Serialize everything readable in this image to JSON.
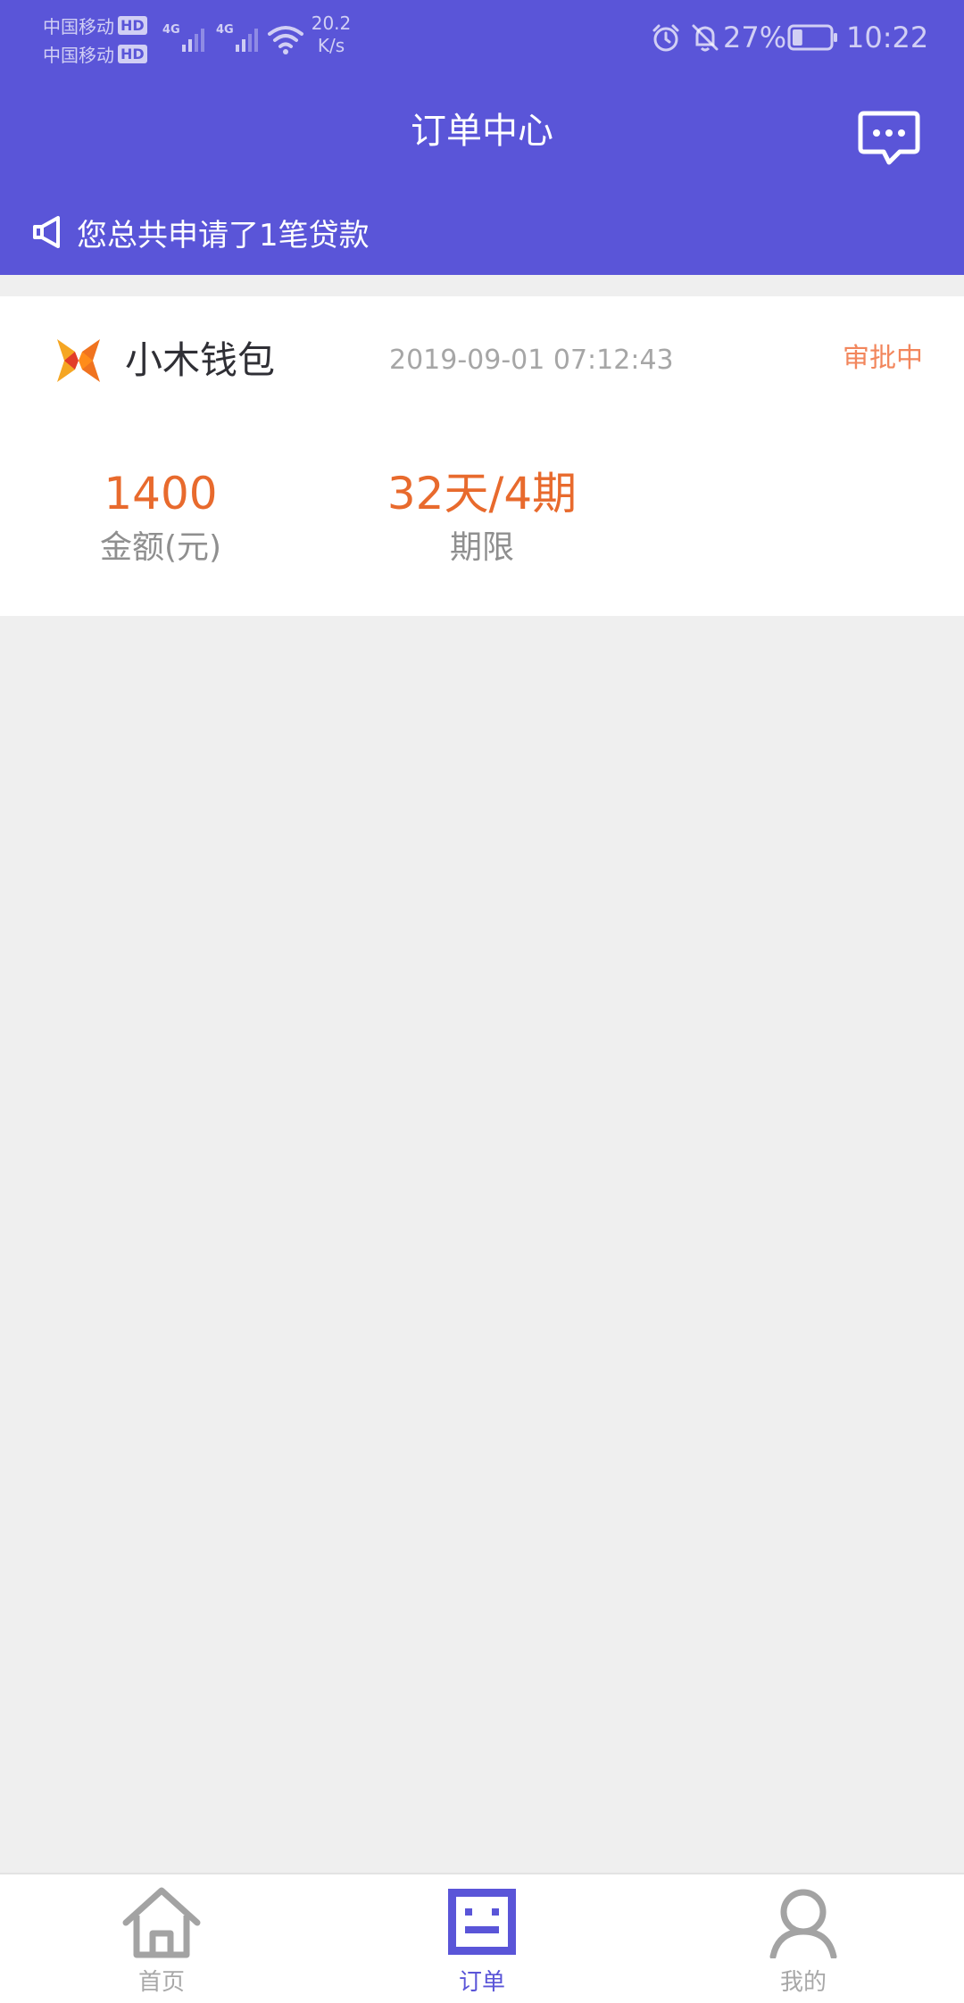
{
  "status_bar": {
    "carrier1": "中国移动",
    "carrier2": "中国移动",
    "hd_badge": "HD",
    "network_type": "4G",
    "speed_value": "20.2",
    "speed_unit": "K/s",
    "battery_percent": "27%",
    "battery_level": 0.27,
    "time": "10:22",
    "icons": [
      "alarm-icon",
      "mute-icon",
      "wifi-icon",
      "signal-icon",
      "battery-icon"
    ]
  },
  "header": {
    "title": "订单中心",
    "message_icon": "chat-bubble-icon",
    "notice_icon": "megaphone-icon",
    "notice": "您总共申请了1笔贷款"
  },
  "order": {
    "brand_name": "小木钱包",
    "brand_logo": "xiaomu-logo",
    "time": "2019-09-01 07:12:43",
    "status": "审批中",
    "amount_value": "1400",
    "amount_label": "金额(元)",
    "term_value": "32天/4期",
    "term_label": "期限"
  },
  "bottom_nav": {
    "items": [
      {
        "label": "首页",
        "icon": "home-icon",
        "active": false
      },
      {
        "label": "订单",
        "icon": "orders-icon",
        "active": true
      },
      {
        "label": "我的",
        "icon": "profile-icon",
        "active": false
      }
    ]
  },
  "colors": {
    "brand_purple": "#5a55d8",
    "amount_orange": "#e86a2d",
    "status_orange": "#f2865c",
    "background": "#efefef"
  }
}
